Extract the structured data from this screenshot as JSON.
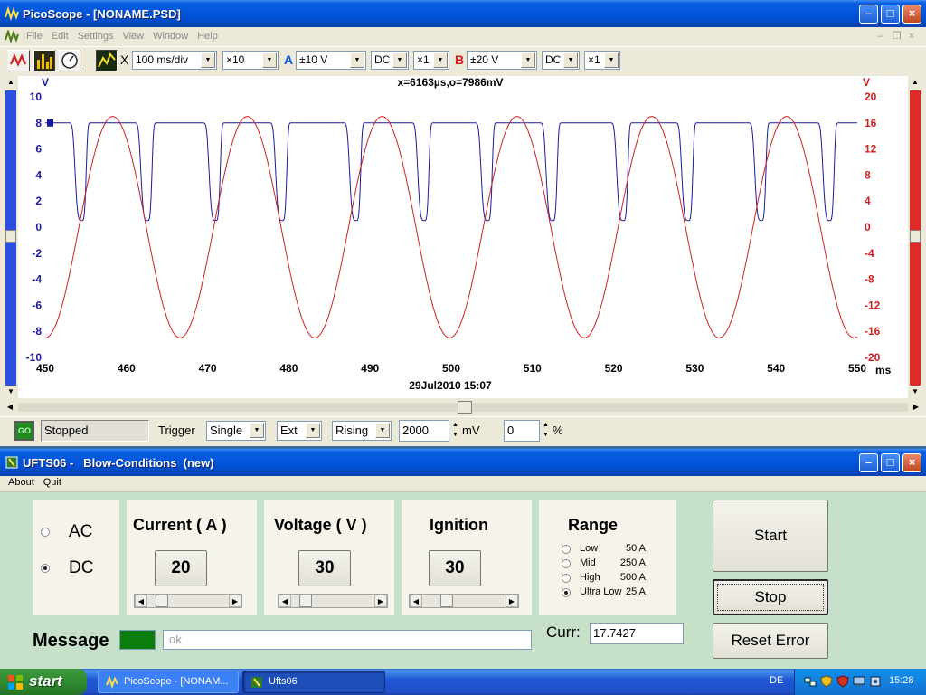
{
  "picoscope": {
    "title": "PicoScope - [NONAME.PSD]",
    "menu": [
      "File",
      "Edit",
      "Settings",
      "View",
      "Window",
      "Help"
    ],
    "toolbar": {
      "x_label": "X",
      "timebase": "100 ms/div",
      "zoom": "×10",
      "ch_a_label": "A",
      "ch_a_range": "±10 V",
      "ch_a_coupling": "DC",
      "ch_a_probe": "×1",
      "ch_b_label": "B",
      "ch_b_range": "±20 V",
      "ch_b_coupling": "DC",
      "ch_b_probe": "×1"
    },
    "status_bar": {
      "go_label": "GO",
      "status": "Stopped",
      "trigger_label": "Trigger",
      "trigger_mode": "Single",
      "trigger_source": "Ext",
      "trigger_edge": "Rising",
      "trigger_level": "2000",
      "level_unit": "mV",
      "pretrigger": "0",
      "pretrigger_unit": "%"
    },
    "colors": {
      "channel_a": "#1a1a9c",
      "channel_b": "#d21e1e",
      "accent_blue": "#0054e3"
    }
  },
  "chart_data": {
    "type": "line",
    "cursor_readout": "x=6163µs,o=7986mV",
    "timestamp": "29Jul2010  15:07",
    "left_axis": {
      "unit": "V",
      "ylim": [
        -10,
        10
      ],
      "ticks": [
        "10",
        "8",
        "6",
        "4",
        "2",
        "0",
        "-2",
        "-4",
        "-6",
        "-8",
        "-10"
      ]
    },
    "right_axis": {
      "unit": "V",
      "ylim": [
        -20,
        20
      ],
      "ticks": [
        "20",
        "16",
        "12",
        "8",
        "4",
        "0",
        "-4",
        "-8",
        "-12",
        "-16",
        "-20"
      ]
    },
    "x_axis": {
      "unit": "ms",
      "xlim": [
        450,
        550
      ],
      "ticks": [
        "450",
        "460",
        "470",
        "480",
        "490",
        "500",
        "510",
        "520",
        "530",
        "540",
        "550"
      ]
    },
    "series": [
      {
        "channel": "A",
        "axis": "left",
        "color": "#1a1a9c",
        "baseline": 8,
        "dips": [
          {
            "x": 454.5,
            "min": 0.5
          },
          {
            "x": 462.6,
            "min": 0.5
          },
          {
            "x": 471.0,
            "min": 0.5
          },
          {
            "x": 479.2,
            "min": 0.5
          },
          {
            "x": 488.3,
            "min": 0.5
          },
          {
            "x": 496.7,
            "min": 0.5
          },
          {
            "x": 504.5,
            "min": 0.5
          },
          {
            "x": 512.5,
            "min": 0.5
          },
          {
            "x": 521.2,
            "min": 0.5
          },
          {
            "x": 529.2,
            "min": 0.5
          },
          {
            "x": 538.2,
            "min": 0.5
          },
          {
            "x": 546.6,
            "min": 0.5
          }
        ]
      },
      {
        "channel": "B",
        "axis": "right",
        "color": "#d21e1e",
        "amplitude": 17,
        "period_ms": 16.6,
        "peak_at_ms": 458.3
      }
    ]
  },
  "ufts": {
    "title": "UFTS06 -   Blow-Conditions  (new)",
    "menu": [
      "About",
      "Quit"
    ],
    "mode": {
      "options": [
        "AC",
        "DC"
      ],
      "selected": "DC"
    },
    "current": {
      "label": "Current ( A )",
      "value": "20",
      "slider_fraction": 0.1
    },
    "voltage": {
      "label": "Voltage ( V )",
      "value": "30",
      "slider_fraction": 0.1
    },
    "ignition": {
      "label": "Ignition",
      "value": "30",
      "slider_fraction": 0.25
    },
    "range": {
      "label": "Range",
      "options": [
        {
          "name": "Low",
          "amps": "50 A"
        },
        {
          "name": "Mid",
          "amps": "250 A"
        },
        {
          "name": "High",
          "amps": "500 A"
        },
        {
          "name": "Ultra Low",
          "amps": "25 A"
        }
      ],
      "selected": "Ultra Low"
    },
    "buttons": {
      "start": "Start",
      "stop": "Stop",
      "reset": "Reset Error"
    },
    "curr_label": "Curr:",
    "curr_value": "17.7427",
    "message_label": "Message",
    "message_text": "ok",
    "message_color": "#0a7d0a"
  },
  "taskbar": {
    "start_label": "start",
    "tasks": [
      "PicoScope - [NONAM...",
      "Ufts06"
    ],
    "language": "DE",
    "clock": "15:28"
  }
}
